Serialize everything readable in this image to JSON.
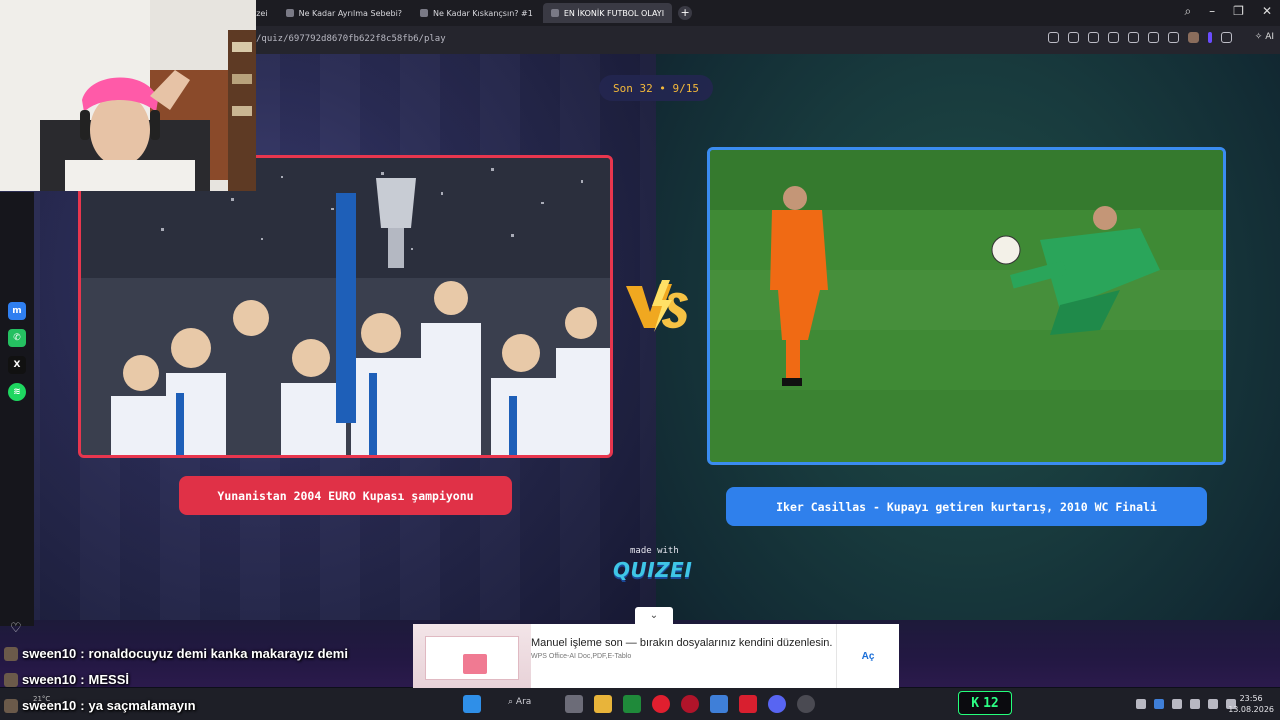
{
  "browser": {
    "tabs": [
      {
        "label": "izei"
      },
      {
        "label": "Ne Kadar Ayrılma Sebebi?"
      },
      {
        "label": "Ne Kadar Kıskançsın? #1"
      },
      {
        "label": "EN İKONİK FUTBOL OLAYI"
      }
    ],
    "new_tab_label": "+",
    "url": "/quiz/697792d8670fb622f8c58fb6/play",
    "ai_label": "AI"
  },
  "quiz": {
    "round_label": "Son 32 • 9/15",
    "left_option": "Yunanistan 2004 EURO Kupası şampiyonu",
    "right_option": "Iker Casillas - Kupayı getiren kurtarış, 2010 WC Finali",
    "made_with": "made with",
    "brand": "QUIZEI"
  },
  "chat": [
    {
      "user": "sween10",
      "message": "ronaldocuyuz demi kanka makarayız demi"
    },
    {
      "user": "sween10",
      "message": "MESSİ"
    },
    {
      "user": "sween10",
      "message": "ya saçmalamayın"
    }
  ],
  "ad": {
    "title": "Manuel işleme son — bırakın dosyalarınız kendini düzenlesin.",
    "subtitle": "WPS Office-AI Doc,PDF,E-Tablo",
    "cta": "Aç"
  },
  "taskbar": {
    "temperature": "21°C",
    "search_label": "Ara",
    "score_value": "12",
    "time": "23:56",
    "date": "13.08.2026"
  },
  "colors": {
    "left_accent": "#e8364e",
    "right_accent": "#3b8cf0",
    "round_text": "#f4b93a",
    "score_green": "#2cff84"
  }
}
